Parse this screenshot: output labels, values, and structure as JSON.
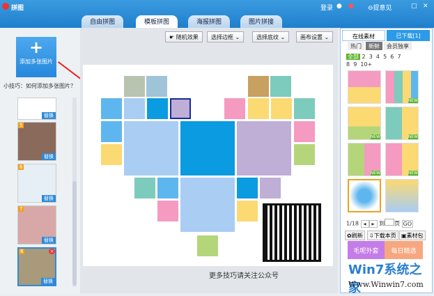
{
  "app": {
    "title": "拼图",
    "login": "登录",
    "feedback": "提意见"
  },
  "tabs": [
    {
      "label": "自由拼图"
    },
    {
      "label": "模板拼图"
    },
    {
      "label": "海报拼图"
    },
    {
      "label": "图片拼接"
    }
  ],
  "left": {
    "add_label": "添加多张图片",
    "tip": "小技巧：如何添加多张图片？",
    "replace": "替换",
    "badges": [
      "5",
      "6",
      "7",
      "8"
    ]
  },
  "toolbar": {
    "random": "随机效果",
    "border": "选择边框",
    "texture": "选择底纹",
    "canvas": "画布设置"
  },
  "footer": "更多技巧请关注公众号",
  "right": {
    "tab_online": "在线素材",
    "tab_downloaded": "已下载[1]",
    "filters": [
      "热门",
      "新鲜",
      "会员独享"
    ],
    "nums": [
      "全部",
      "2",
      "3",
      "4",
      "5",
      "6",
      "7",
      "8",
      "9",
      "10+"
    ],
    "page": "1/18",
    "goto": "到",
    "page_unit": "页",
    "go": "GO",
    "refresh": "刷新",
    "download_page": "下载本页",
    "pack": "素材包",
    "banner1": "毛呢外套",
    "banner2": "每日精选",
    "new": "NEW"
  },
  "watermark": {
    "brand": "Win7系统之家",
    "url": "Www.Winwin7.com"
  },
  "colors": {
    "lightblue": "#a9cdf3",
    "blue": "#0a9be0",
    "purple": "#bfaed6",
    "pink": "#f59ac1",
    "yellow": "#fbd973",
    "teal": "#7dcbbd",
    "green": "#b5d57a",
    "skyblue": "#5eb6ee"
  }
}
